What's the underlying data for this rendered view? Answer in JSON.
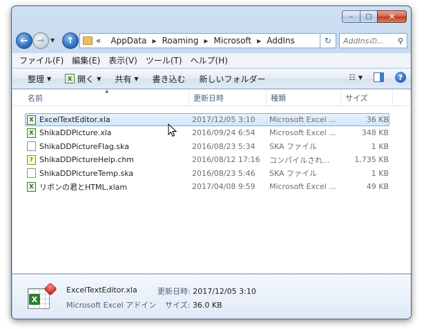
{
  "window": {
    "caption_buttons": {
      "minimize": "–",
      "maximize": "□",
      "close": "✕"
    }
  },
  "nav": {
    "back_icon": "←",
    "forward_icon": "→",
    "history_icon": "▼",
    "up_icon": "↑",
    "address": [
      "AppData",
      "Roaming",
      "Microsoft",
      "AddIns"
    ],
    "address_prefix": "«",
    "crumb_separator": "▶",
    "refresh_icon": "↻",
    "search_placeholder": "AddInsの...",
    "search_icon": "⚲"
  },
  "menu": [
    "ファイル(F)",
    "編集(E)",
    "表示(V)",
    "ツール(T)",
    "ヘルプ(H)"
  ],
  "toolbar": {
    "organize": "整理",
    "open": "開く",
    "share": "共有",
    "burn": "書き込む",
    "new_folder": "新しいフォルダー",
    "caret": "▼",
    "view_icon": "☷",
    "help_icon": "?",
    "open_icon": "X"
  },
  "columns": {
    "name": "名前",
    "date": "更新日時",
    "type": "種類",
    "size": "サイズ",
    "sort_indicator": "▲"
  },
  "files": [
    {
      "name": "ExcelTextEditor.xla",
      "date": "2017/12/05 3:10",
      "type": "Microsoft Excel ...",
      "size": "36 KB",
      "icon": "excel-addin",
      "glyph": "X",
      "selected": true
    },
    {
      "name": "ShikaDDPicture.xla",
      "date": "2016/09/24 6:54",
      "type": "Microsoft Excel ...",
      "size": "348 KB",
      "icon": "excel-addin",
      "glyph": "X",
      "selected": false
    },
    {
      "name": "ShikaDDPictureFlag.ska",
      "date": "2016/08/23 5:34",
      "type": "SKA ファイル",
      "size": "1 KB",
      "icon": "generic-file",
      "glyph": "",
      "selected": false
    },
    {
      "name": "ShikaDDPictureHelp.chm",
      "date": "2016/08/12 17:16",
      "type": "コンパイルされ...",
      "size": "1,735 KB",
      "icon": "chm-help",
      "glyph": "?",
      "selected": false
    },
    {
      "name": "ShikaDDPictureTemp.ska",
      "date": "2016/08/23 5:46",
      "type": "SKA ファイル",
      "size": "1 KB",
      "icon": "generic-file",
      "glyph": "",
      "selected": false
    },
    {
      "name": "リボンの君とHTML.xlam",
      "date": "2017/04/08 9:59",
      "type": "Microsoft Excel ...",
      "size": "49 KB",
      "icon": "excel-addin",
      "glyph": "X",
      "selected": false
    }
  ],
  "details": {
    "name": "ExcelTextEditor.xla",
    "type": "Microsoft Excel アドイン",
    "modified_label": "更新日時:",
    "modified_value": "2017/12/05 3:10",
    "size_label": "サイズ:",
    "size_value": "36.0 KB",
    "badge": "X"
  },
  "colors": {
    "selection_border": "#84acdd",
    "selection_fill": "#d4e6fb",
    "chrome": "#b9d1ea",
    "close_button": "#c0391d"
  }
}
